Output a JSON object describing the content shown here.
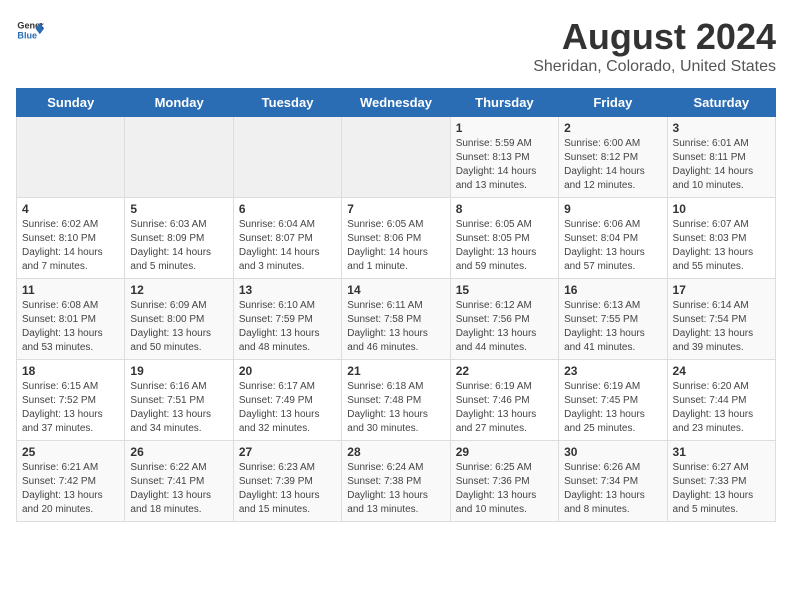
{
  "header": {
    "logo_general": "General",
    "logo_blue": "Blue",
    "title": "August 2024",
    "subtitle": "Sheridan, Colorado, United States"
  },
  "weekdays": [
    "Sunday",
    "Monday",
    "Tuesday",
    "Wednesday",
    "Thursday",
    "Friday",
    "Saturday"
  ],
  "weeks": [
    [
      {
        "day": "",
        "content": ""
      },
      {
        "day": "",
        "content": ""
      },
      {
        "day": "",
        "content": ""
      },
      {
        "day": "",
        "content": ""
      },
      {
        "day": "1",
        "content": "Sunrise: 5:59 AM\nSunset: 8:13 PM\nDaylight: 14 hours\nand 13 minutes."
      },
      {
        "day": "2",
        "content": "Sunrise: 6:00 AM\nSunset: 8:12 PM\nDaylight: 14 hours\nand 12 minutes."
      },
      {
        "day": "3",
        "content": "Sunrise: 6:01 AM\nSunset: 8:11 PM\nDaylight: 14 hours\nand 10 minutes."
      }
    ],
    [
      {
        "day": "4",
        "content": "Sunrise: 6:02 AM\nSunset: 8:10 PM\nDaylight: 14 hours\nand 7 minutes."
      },
      {
        "day": "5",
        "content": "Sunrise: 6:03 AM\nSunset: 8:09 PM\nDaylight: 14 hours\nand 5 minutes."
      },
      {
        "day": "6",
        "content": "Sunrise: 6:04 AM\nSunset: 8:07 PM\nDaylight: 14 hours\nand 3 minutes."
      },
      {
        "day": "7",
        "content": "Sunrise: 6:05 AM\nSunset: 8:06 PM\nDaylight: 14 hours\nand 1 minute."
      },
      {
        "day": "8",
        "content": "Sunrise: 6:05 AM\nSunset: 8:05 PM\nDaylight: 13 hours\nand 59 minutes."
      },
      {
        "day": "9",
        "content": "Sunrise: 6:06 AM\nSunset: 8:04 PM\nDaylight: 13 hours\nand 57 minutes."
      },
      {
        "day": "10",
        "content": "Sunrise: 6:07 AM\nSunset: 8:03 PM\nDaylight: 13 hours\nand 55 minutes."
      }
    ],
    [
      {
        "day": "11",
        "content": "Sunrise: 6:08 AM\nSunset: 8:01 PM\nDaylight: 13 hours\nand 53 minutes."
      },
      {
        "day": "12",
        "content": "Sunrise: 6:09 AM\nSunset: 8:00 PM\nDaylight: 13 hours\nand 50 minutes."
      },
      {
        "day": "13",
        "content": "Sunrise: 6:10 AM\nSunset: 7:59 PM\nDaylight: 13 hours\nand 48 minutes."
      },
      {
        "day": "14",
        "content": "Sunrise: 6:11 AM\nSunset: 7:58 PM\nDaylight: 13 hours\nand 46 minutes."
      },
      {
        "day": "15",
        "content": "Sunrise: 6:12 AM\nSunset: 7:56 PM\nDaylight: 13 hours\nand 44 minutes."
      },
      {
        "day": "16",
        "content": "Sunrise: 6:13 AM\nSunset: 7:55 PM\nDaylight: 13 hours\nand 41 minutes."
      },
      {
        "day": "17",
        "content": "Sunrise: 6:14 AM\nSunset: 7:54 PM\nDaylight: 13 hours\nand 39 minutes."
      }
    ],
    [
      {
        "day": "18",
        "content": "Sunrise: 6:15 AM\nSunset: 7:52 PM\nDaylight: 13 hours\nand 37 minutes."
      },
      {
        "day": "19",
        "content": "Sunrise: 6:16 AM\nSunset: 7:51 PM\nDaylight: 13 hours\nand 34 minutes."
      },
      {
        "day": "20",
        "content": "Sunrise: 6:17 AM\nSunset: 7:49 PM\nDaylight: 13 hours\nand 32 minutes."
      },
      {
        "day": "21",
        "content": "Sunrise: 6:18 AM\nSunset: 7:48 PM\nDaylight: 13 hours\nand 30 minutes."
      },
      {
        "day": "22",
        "content": "Sunrise: 6:19 AM\nSunset: 7:46 PM\nDaylight: 13 hours\nand 27 minutes."
      },
      {
        "day": "23",
        "content": "Sunrise: 6:19 AM\nSunset: 7:45 PM\nDaylight: 13 hours\nand 25 minutes."
      },
      {
        "day": "24",
        "content": "Sunrise: 6:20 AM\nSunset: 7:44 PM\nDaylight: 13 hours\nand 23 minutes."
      }
    ],
    [
      {
        "day": "25",
        "content": "Sunrise: 6:21 AM\nSunset: 7:42 PM\nDaylight: 13 hours\nand 20 minutes."
      },
      {
        "day": "26",
        "content": "Sunrise: 6:22 AM\nSunset: 7:41 PM\nDaylight: 13 hours\nand 18 minutes."
      },
      {
        "day": "27",
        "content": "Sunrise: 6:23 AM\nSunset: 7:39 PM\nDaylight: 13 hours\nand 15 minutes."
      },
      {
        "day": "28",
        "content": "Sunrise: 6:24 AM\nSunset: 7:38 PM\nDaylight: 13 hours\nand 13 minutes."
      },
      {
        "day": "29",
        "content": "Sunrise: 6:25 AM\nSunset: 7:36 PM\nDaylight: 13 hours\nand 10 minutes."
      },
      {
        "day": "30",
        "content": "Sunrise: 6:26 AM\nSunset: 7:34 PM\nDaylight: 13 hours\nand 8 minutes."
      },
      {
        "day": "31",
        "content": "Sunrise: 6:27 AM\nSunset: 7:33 PM\nDaylight: 13 hours\nand 5 minutes."
      }
    ]
  ]
}
